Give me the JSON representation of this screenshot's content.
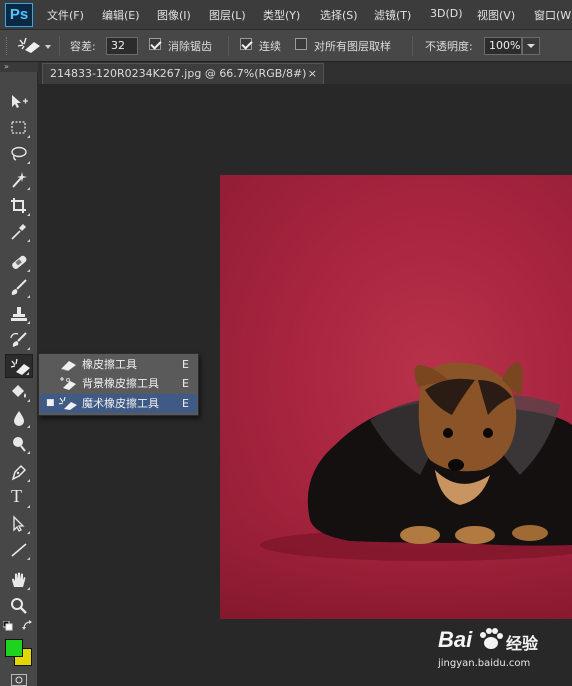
{
  "app": {
    "logo": "Ps"
  },
  "menu": [
    "文件(F)",
    "编辑(E)",
    "图像(I)",
    "图层(L)",
    "类型(Y)",
    "选择(S)",
    "滤镜(T)",
    "3D(D)",
    "视图(V)",
    "窗口(W"
  ],
  "options": {
    "tolerance_label": "容差:",
    "tolerance_value": "32",
    "antialias_label": "消除锯齿",
    "antialias_checked": true,
    "contiguous_label": "连续",
    "contiguous_checked": true,
    "sample_all_label": "对所有图层取样",
    "sample_all_checked": false,
    "opacity_label": "不透明度:",
    "opacity_value": "100%"
  },
  "document_tab": {
    "title": "214833-120R0234K267.jpg @ 66.7%(RGB/8#)",
    "close_glyph": "×"
  },
  "tools": [
    "move-tool",
    "marquee-tool",
    "lasso-tool",
    "magic-wand-tool",
    "crop-tool",
    "eyedropper-tool",
    "healing-brush-tool",
    "brush-tool",
    "clone-stamp-tool",
    "history-brush-tool",
    "eraser-tool",
    "paint-bucket-tool",
    "blur-tool",
    "dodge-tool",
    "pen-tool",
    "type-tool",
    "path-selection-tool",
    "line-tool",
    "hand-tool",
    "zoom-tool"
  ],
  "type_tool_glyph": "T",
  "flyout": {
    "items": [
      {
        "label": "橡皮擦工具",
        "shortcut": "E",
        "selected": false
      },
      {
        "label": "背景橡皮擦工具",
        "shortcut": "E",
        "selected": false
      },
      {
        "label": "魔术橡皮擦工具",
        "shortcut": "E",
        "selected": true
      }
    ],
    "selected_bullet": "■"
  },
  "colors": {
    "foreground": "#1fd21f",
    "background": "#e3d700",
    "photo_backdrop": "#a92540",
    "selection": "#3f5b85"
  },
  "watermark": {
    "brand": "Bai",
    "brand_end": "经验",
    "url": "jingyan.baidu.com"
  }
}
